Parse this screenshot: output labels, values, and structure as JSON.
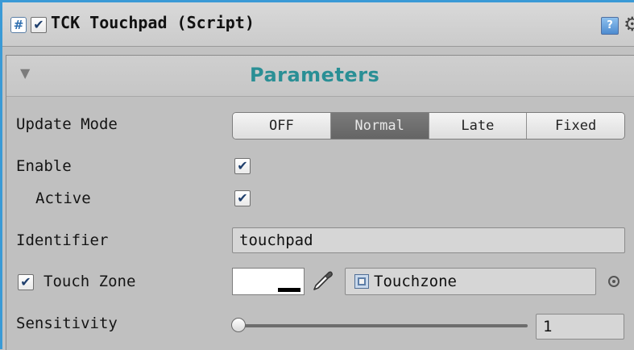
{
  "component": {
    "title": "TCK Touchpad (Script)",
    "enabled_checkmark": "✔",
    "icons": [
      "script-icon",
      "book-icon",
      "gear-icon"
    ]
  },
  "section": {
    "title": "Parameters",
    "foldout_glyph": "▼"
  },
  "fields": {
    "update_mode": {
      "label": "Update Mode",
      "options": [
        "OFF",
        "Normal",
        "Late",
        "Fixed"
      ],
      "selected": "Normal"
    },
    "enable": {
      "label": "Enable",
      "check": "✔"
    },
    "active": {
      "label": "Active",
      "check": "✔"
    },
    "identifier": {
      "label": "Identifier",
      "value": "touchpad"
    },
    "touch_zone": {
      "label": "Touch Zone",
      "check": "✔",
      "color": "#ffffff",
      "object": "Touchzone"
    },
    "sensitivity": {
      "label": "Sensitivity",
      "value": "1",
      "slider_fraction": 0
    }
  },
  "colors": {
    "accent": "#2a8f95",
    "selection": "#3a9ad6"
  }
}
